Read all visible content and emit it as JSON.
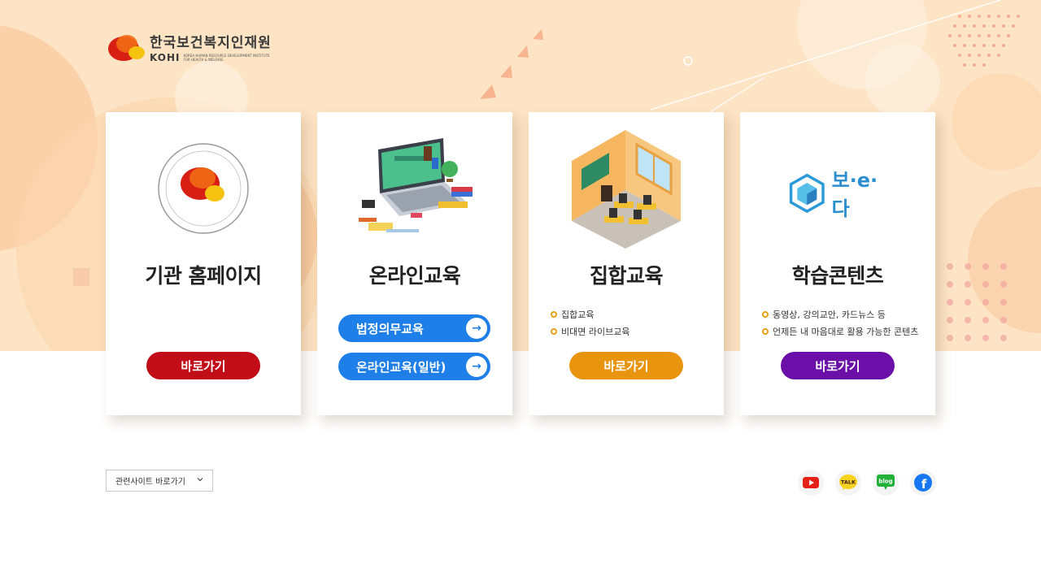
{
  "logo": {
    "name_ko": "한국보건복지인재원",
    "name_en": "KOHI",
    "subtitle": "KOREA HUMAN RESOURCE DEVELOPMENT INSTITUTE FOR HEALTH & WELFARE"
  },
  "cards": [
    {
      "title": "기관 홈페이지",
      "seal_text_outer": "KOREA HUMAN RESOURCE DEVELOPMENT INSTITUTE FOR HEALTH & WELFARE",
      "seal_text_inner": "한국보건복지인재원",
      "button_label": "바로가기",
      "button_color": "#c00d18"
    },
    {
      "title": "온라인교육",
      "buttons": [
        {
          "label": "법정의무교육",
          "arrow": "→"
        },
        {
          "label": "온라인교육(일반)",
          "arrow": "→"
        }
      ],
      "button_color": "#1e7fe8"
    },
    {
      "title": "집합교육",
      "bullets": [
        "집합교육",
        "비대면 라이브교육"
      ],
      "button_label": "바로가기",
      "button_color": "#e8940e"
    },
    {
      "title": "학습콘텐츠",
      "brand": "보·e·다",
      "bullets": [
        "동영상, 강의교안, 카드뉴스 등",
        "언제든 내 마음대로 활용 가능한 콘텐츠"
      ],
      "button_label": "바로가기",
      "button_color": "#6a0fa8"
    }
  ],
  "footer": {
    "related_sites_label": "관련사이트 바로가기",
    "social": [
      {
        "icon": "youtube-icon",
        "color": "#e62117"
      },
      {
        "icon": "kakao-talk-icon",
        "label": "TALK",
        "color": "#3c1e1e"
      },
      {
        "icon": "naver-blog-icon",
        "label": "blog",
        "color": "#21b139"
      },
      {
        "icon": "facebook-icon",
        "label": "f",
        "color": "#1877f2"
      }
    ]
  }
}
